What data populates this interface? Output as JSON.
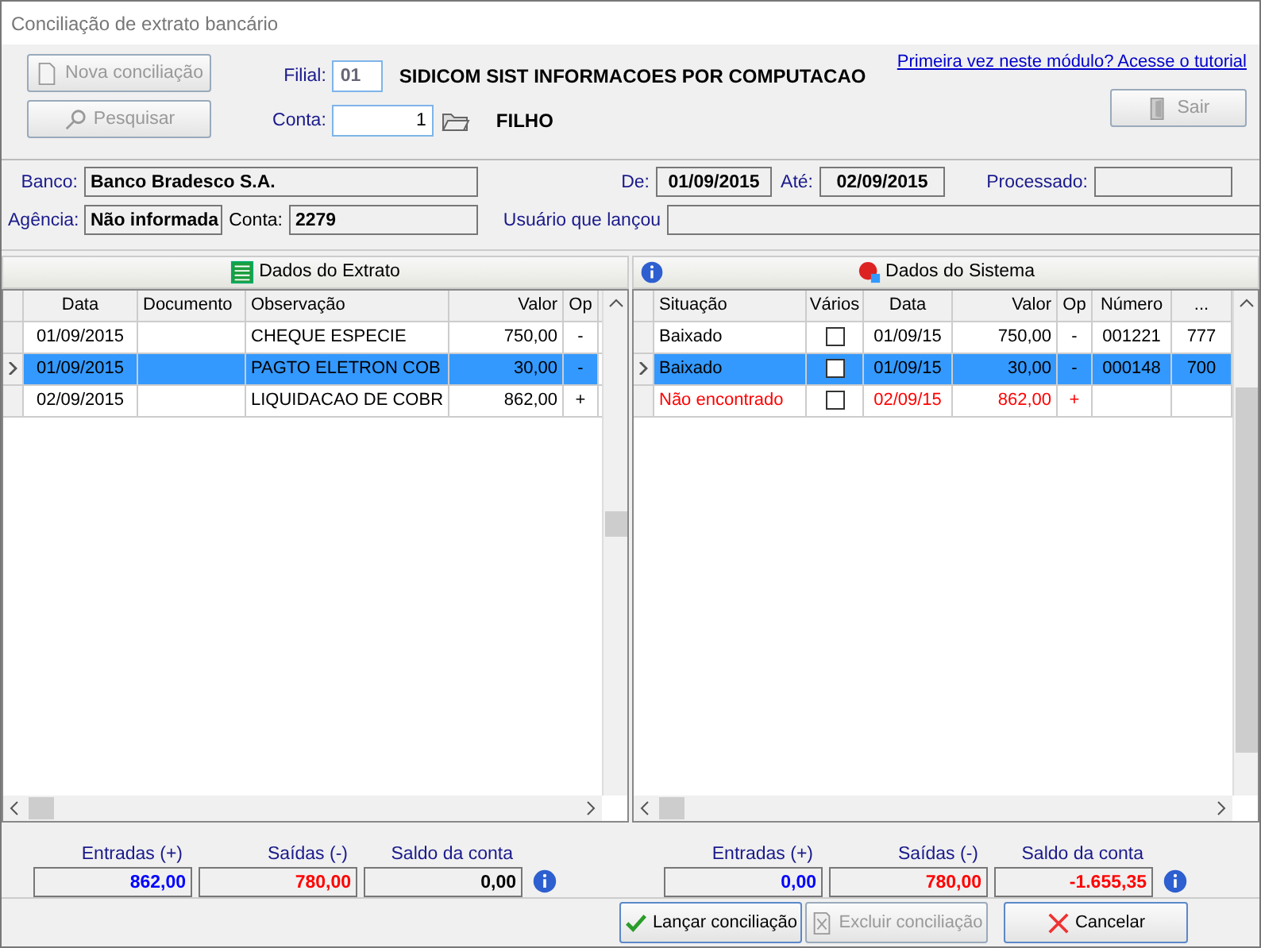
{
  "window": {
    "title": "Conciliação de extrato bancário"
  },
  "header": {
    "buttons": [
      {
        "label": "Nova conciliação",
        "disabled": true
      },
      {
        "label": "Pesquisar",
        "disabled": true
      }
    ],
    "filial_label": "Filial:",
    "filial": "01",
    "company": "SIDICOM SIST INFORMACOES POR COMPUTACAO",
    "conta_label": "Conta:",
    "conta": "1",
    "conta_name": "FILHO",
    "tutorial_link": "Primeira vez neste módulo? Acesse o tutorial",
    "exit_button": {
      "label": "Sair",
      "disabled": true
    }
  },
  "info": {
    "banco_label": "Banco:",
    "banco": "Banco Bradesco S.A.",
    "de_label": "De:",
    "de": "01/09/2015",
    "ate_label": "Até:",
    "ate": "02/09/2015",
    "processado_label": "Processado:",
    "agencia_label": "Agência:",
    "agencia": "Não informada",
    "conta_label": "Conta:",
    "conta": "2279",
    "usuario_label": "Usuário que lançou"
  },
  "statement": {
    "title": "Dados do Extrato",
    "columns": [
      "Data",
      "Documento",
      "Observação",
      "Valor",
      "Op"
    ],
    "rows": [
      {
        "selected": false,
        "cells": [
          "01/09/2015",
          "",
          "CHEQUE ESPECIE",
          "750,00",
          "-"
        ]
      },
      {
        "selected": true,
        "cells": [
          "01/09/2015",
          "",
          "PAGTO ELETRON  COB",
          "30,00",
          "-"
        ]
      },
      {
        "selected": false,
        "cells": [
          "02/09/2015",
          "",
          "LIQUIDACAO DE COBR",
          "862,00",
          "+"
        ]
      }
    ],
    "totals": [
      {
        "label": "Entradas (+)",
        "value": "862,00",
        "color": "#0000ff"
      },
      {
        "label": "Saídas (-)",
        "value": "780,00",
        "color": "#ff0000"
      },
      {
        "label": "Saldo da conta",
        "value": "0,00",
        "color": "#000000"
      }
    ]
  },
  "system": {
    "title": "Dados do Sistema",
    "columns": [
      "Situação",
      "Vários",
      "Data",
      "Valor",
      "Op",
      "Número",
      "..."
    ],
    "rows": [
      {
        "selected": false,
        "found": true,
        "checked": false,
        "cells": [
          "Baixado",
          "",
          "01/09/15",
          "750,00",
          "-",
          "001221",
          "777"
        ]
      },
      {
        "selected": true,
        "found": true,
        "checked": false,
        "cells": [
          "Baixado",
          "",
          "01/09/15",
          "30,00",
          "-",
          "000148",
          "700"
        ]
      },
      {
        "selected": false,
        "found": false,
        "checked": false,
        "cells": [
          "Não encontrado",
          "",
          "02/09/15",
          "862,00",
          "+",
          "",
          ""
        ]
      }
    ],
    "totals": [
      {
        "label": "Entradas (+)",
        "value": "0,00",
        "color": "#0000ff"
      },
      {
        "label": "Saídas (-)",
        "value": "780,00",
        "color": "#ff0000"
      },
      {
        "label": "Saldo da conta",
        "value": "-1.655,35",
        "color": "#ff0000"
      }
    ]
  },
  "footer_buttons": [
    {
      "label": "Lançar conciliação",
      "disabled": false
    },
    {
      "label": "Excluir conciliação",
      "disabled": true
    },
    {
      "label": "Cancelar",
      "disabled": false
    }
  ]
}
